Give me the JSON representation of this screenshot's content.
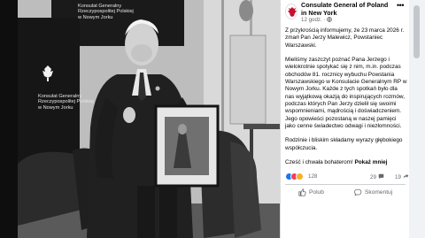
{
  "post": {
    "page_name": "Consulate General of Poland in New York",
    "time": "12 godz.",
    "separator": "·",
    "more_icon": "ellipsis-icon",
    "paragraphs": [
      "Z przykrością informujemy, że 23 marca 2026 r. zmarł Pan Jerzy Malewicz, Powstaniec Warszawski.",
      "Mieliśmy zaszczyt poznać Pana Jerzego i wielokrotnie spotykać się z nim, m.in. podczas obchodów 81. rocznicy wybuchu Powstania Warszawskiego w Konsulacie Generalnym RP w Nowym Jorku. Każde z tych spotkań było dla nas wyjątkową okazją do inspirujących rozmów, podczas których Pan Jerzy dzielił się swoimi wspomnieniami, mądrością i doświadczeniem. Jego opowieści pozostaną w naszej pamięci jako cenne świadectwo odwagi i niezłomności.",
      "Rodzinie i bliskim składamy wyrazy głębokiego współczucia."
    ],
    "last_line": "Cześć i chwała bohaterom!",
    "see_less": "Pokaż mniej",
    "reaction_count": "128",
    "comment_count": "29",
    "share_count": "19",
    "like_label": "Polub",
    "comment_label": "Skomentuj"
  },
  "photo": {
    "banner_top": [
      "Konsulat Generalny",
      "Rzeczypospolitej Polskiej",
      "w Nowym Jorku"
    ],
    "banner_left": [
      "Konsulat Generalny",
      "Rzeczypospolitej Polskiej",
      "w Nowym Jorku"
    ]
  },
  "colors": {
    "accent": "#1877f2",
    "reaction_like": "#1877f2",
    "reaction_love": "#f33e58",
    "reaction_care": "#f7b125"
  }
}
